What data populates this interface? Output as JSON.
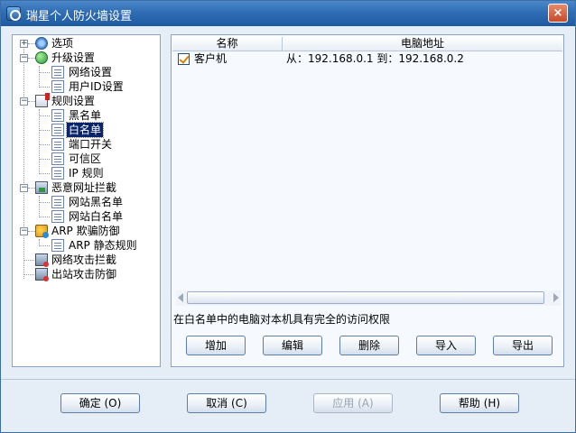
{
  "window": {
    "title": "瑞星个人防火墙设置",
    "close_label": "×"
  },
  "tree": {
    "items": [
      {
        "label": "选项",
        "icon": "gear-icon"
      },
      {
        "label": "升级设置",
        "icon": "globe-check-icon"
      },
      {
        "label": "网络设置",
        "icon": "document-icon"
      },
      {
        "label": "用户ID设置",
        "icon": "document-icon"
      },
      {
        "label": "规则设置",
        "icon": "rules-icon"
      },
      {
        "label": "黑名单",
        "icon": "document-icon"
      },
      {
        "label": "白名单",
        "icon": "document-icon"
      },
      {
        "label": "端口开关",
        "icon": "document-icon"
      },
      {
        "label": "可信区",
        "icon": "document-icon"
      },
      {
        "label": "IP 规则",
        "icon": "document-icon"
      },
      {
        "label": "恶意网址拦截",
        "icon": "url-block-icon"
      },
      {
        "label": "网站黑名单",
        "icon": "document-icon"
      },
      {
        "label": "网站白名单",
        "icon": "document-icon"
      },
      {
        "label": "ARP 欺骗防御",
        "icon": "arp-shield-icon"
      },
      {
        "label": "ARP 静态规则",
        "icon": "document-icon"
      },
      {
        "label": "网络攻击拦截",
        "icon": "network-attack-icon"
      },
      {
        "label": "出站攻击防御",
        "icon": "outbound-attack-icon"
      }
    ],
    "selected": "白名单",
    "expander_collapsed": "+",
    "expander_expanded": "−"
  },
  "table": {
    "columns": [
      "名称",
      "电脑地址"
    ],
    "rows": [
      {
        "checked": true,
        "name": "客户机",
        "address": "从：192.168.0.1 到：192.168.0.2"
      }
    ]
  },
  "description": "在白名单中的电脑对本机具有完全的访问权限",
  "actions": {
    "add": "增加",
    "edit": "编辑",
    "delete": "删除",
    "import": "导入",
    "export": "导出"
  },
  "footer": {
    "ok": "确定 (O)",
    "cancel": "取消 (C)",
    "apply": "应用 (A)",
    "help": "帮助 (H)"
  },
  "colors": {
    "titlebar": "#2f6db4",
    "selection": "#0a246a",
    "background": "#e5edf7"
  }
}
